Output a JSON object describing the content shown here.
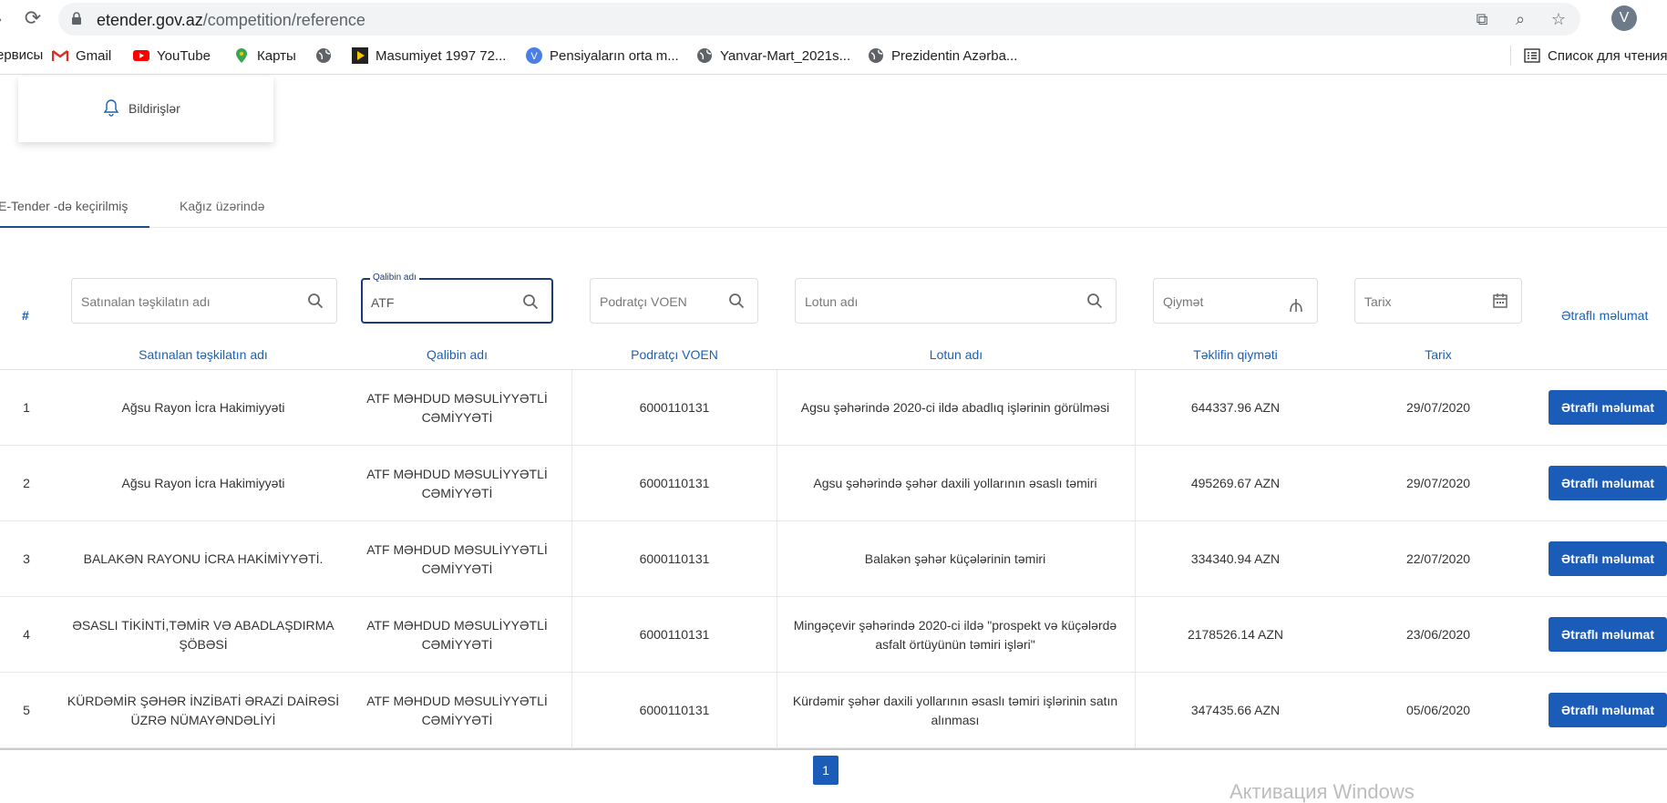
{
  "browser": {
    "url_domain": "etender.gov.az",
    "url_path": "/competition/reference",
    "profile_initial": "V",
    "bookmarks": [
      "ервисы",
      "Gmail",
      "YouTube",
      "Карты",
      "",
      "Masumiyet 1997 72...",
      "Pensiyaların orta m...",
      "Yanvar-Mart_2021s...",
      "Prezidentin Azərba..."
    ],
    "reading_list": "Список для чтения"
  },
  "notifications": {
    "label": "Bildirişlər"
  },
  "tabs": [
    "E-Tender -də keçirilmiş",
    "Kağız üzərində"
  ],
  "filters": {
    "hash": "#",
    "org_placeholder": "Satınalan təşkilatın adı",
    "winner_label": "Qalibin adı",
    "winner_value": "ATF",
    "voen_placeholder": "Podratçı VOEN",
    "lot_placeholder": "Lotun adı",
    "price_placeholder": "Qiymət",
    "date_placeholder": "Tarix",
    "details_header": "Ətraflı məlumat"
  },
  "table": {
    "headers": [
      "Satınalan təşkilatın adı",
      "Qalibin adı",
      "Podratçı VOEN",
      "Lotun adı",
      "Təklifin qiyməti",
      "Tarix"
    ],
    "button_label": "Ətraflı məlumat",
    "rows": [
      {
        "n": "1",
        "org": "Ağsu Rayon İcra Hakimiyyəti",
        "winner": "ATF MƏHDUD MƏSULİYYƏTLİ CƏMİYYƏTİ",
        "voen": "6000110131",
        "lot": "Agsu şəhərində 2020-ci ildə abadlıq işlərinin görülməsi",
        "price": "644337.96 AZN",
        "date": "29/07/2020"
      },
      {
        "n": "2",
        "org": "Ağsu Rayon İcra Hakimiyyəti",
        "winner": "ATF MƏHDUD MƏSULİYYƏTLİ CƏMİYYƏTİ",
        "voen": "6000110131",
        "lot": "Agsu şəhərində şəhər daxili yollarının əsaslı təmiri",
        "price": "495269.67 AZN",
        "date": "29/07/2020"
      },
      {
        "n": "3",
        "org": "BALAKƏN RAYONU İCRA HAKİMİYYƏTİ.",
        "winner": "ATF MƏHDUD MƏSULİYYƏTLİ CƏMİYYƏTİ",
        "voen": "6000110131",
        "lot": "Balakən şəhər küçələrinin təmiri",
        "price": "334340.94 AZN",
        "date": "22/07/2020"
      },
      {
        "n": "4",
        "org": "ƏSASLI TİKİNTİ,TƏMİR VƏ ABADLAŞDIRMA ŞÖBƏSİ",
        "winner": "ATF MƏHDUD MƏSULİYYƏTLİ CƏMİYYƏTİ",
        "voen": "6000110131",
        "lot": "Mingəçevir şəhərində 2020-ci ildə \"prospekt və küçələrdə asfalt örtüyünün təmiri işləri\"",
        "price": "2178526.14 AZN",
        "date": "23/06/2020"
      },
      {
        "n": "5",
        "org": "KÜRDƏMİR ŞƏHƏR İNZİBATİ ƏRAZİ DAİRƏSİ ÜZRƏ NÜMAYƏNDƏLİYİ",
        "winner": "ATF MƏHDUD MƏSULİYYƏTLİ CƏMİYYƏTİ",
        "voen": "6000110131",
        "lot": "Kürdəmir şəhər daxili yollarının əsaslı təmiri işlərinin satın alınması",
        "price": "347435.66 AZN",
        "date": "05/06/2020"
      }
    ]
  },
  "pagination": {
    "current": "1"
  },
  "watermark": "Активация Windows",
  "colors": {
    "accent": "#1a5cb8",
    "header_text": "#1a60b4",
    "focus_border": "#1a3a7a"
  }
}
